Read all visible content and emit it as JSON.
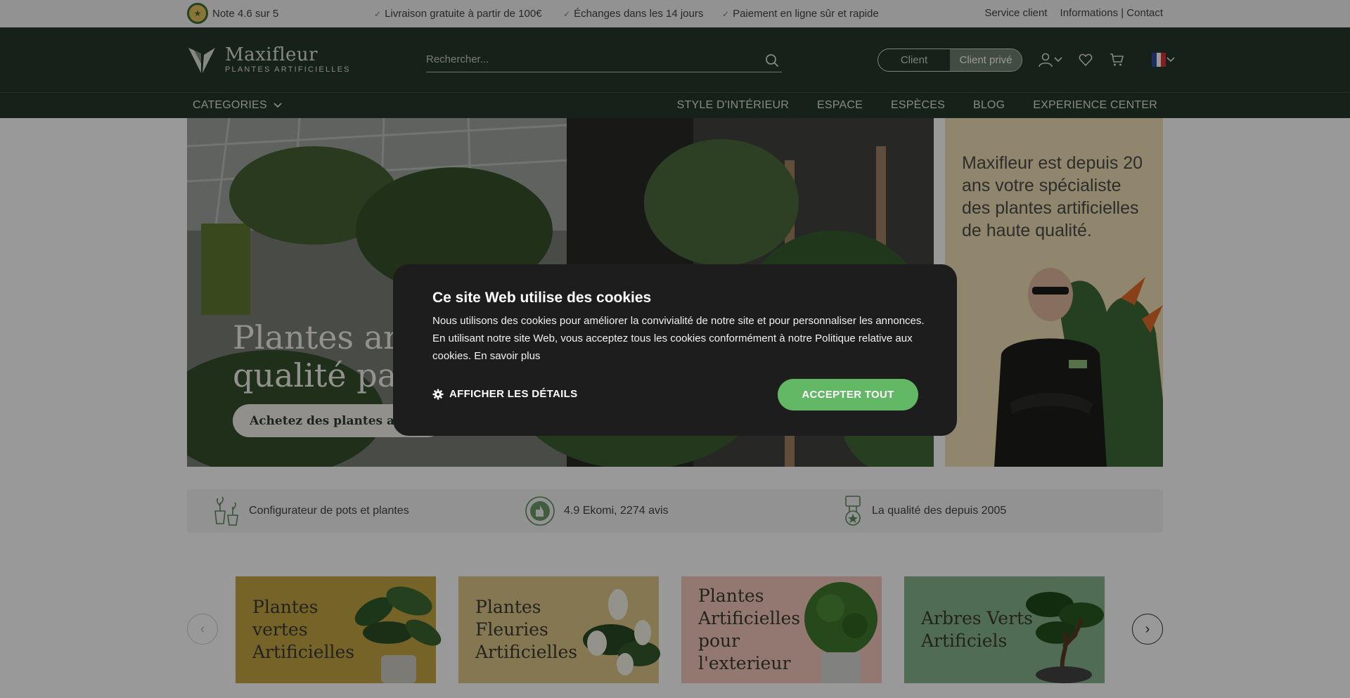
{
  "topbar": {
    "rating": "Note 4.6 sur 5",
    "usps": [
      "Livraison gratuite à partir de 100€",
      "Échanges dans les 14 jours",
      "Paiement en ligne sûr et rapide"
    ],
    "links": [
      "Service client",
      "Informations | Contact"
    ]
  },
  "header": {
    "brand": "Maxifleur",
    "tagline": "PLANTES ARTIFICIELLES",
    "search_placeholder": "Rechercher...",
    "toggle": [
      "Client",
      "Client privé"
    ],
    "icons": [
      "user-icon",
      "heart-icon",
      "cart-icon",
      "flag-fr-icon"
    ]
  },
  "nav": {
    "categories": "CATEGORIES",
    "links": [
      "STYLE D'INTÉRIEUR",
      "ESPACE",
      "ESPÈCES",
      "BLOG",
      "EXPERIENCE CENTER"
    ]
  },
  "hero": {
    "title_line1": "Plantes arti",
    "title_line2": "qualité par",
    "button": "Achetez des plantes artific"
  },
  "promo": {
    "text": "Maxifleur est depuis 20 ans votre spécialiste des plantes artificielles de haute qualité."
  },
  "trust": [
    {
      "icon": "pots-plants-icon",
      "text": "Configurateur de pots et plantes"
    },
    {
      "icon": "ekomi-badge-icon",
      "text": "4.9 Ekomi, 2274 avis"
    },
    {
      "icon": "quality-medal-icon",
      "text": "La qualité des depuis 2005"
    }
  ],
  "categories": [
    {
      "label": "Plantes vertes Artificielles",
      "color": "#c3a543"
    },
    {
      "label": "Plantes Fleuries Artificielles",
      "color": "#ddc689"
    },
    {
      "label": "Plantes Artificielles pour l'exterieur",
      "color": "#f3c8bc"
    },
    {
      "label": "Arbres Verts Artificiels",
      "color": "#86b58d"
    }
  ],
  "cookie": {
    "title": "Ce site Web utilise des cookies",
    "body": "Nous utilisons des cookies pour améliorer la convivialité de notre site et pour personnaliser les annonces. En utilisant notre site Web, vous acceptez tous les cookies conformément à notre Politique relative aux cookies. En savoir plus",
    "details": "AFFICHER LES DÉTAILS",
    "accept": "ACCEPTER TOUT"
  }
}
